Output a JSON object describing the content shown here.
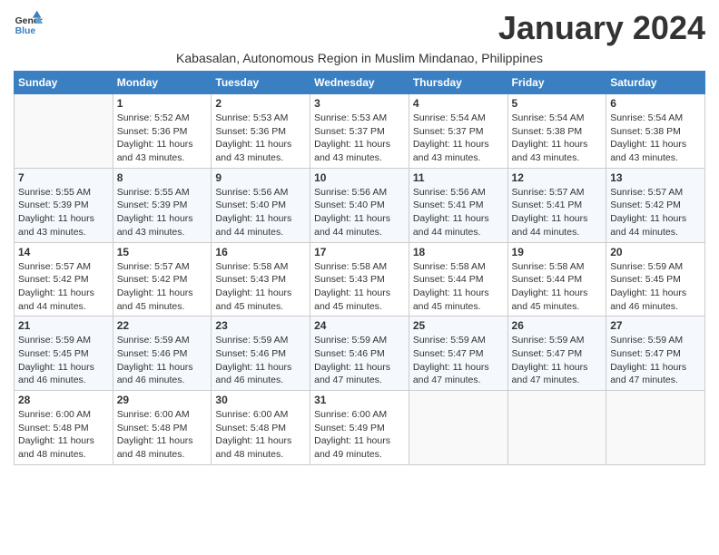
{
  "logo": {
    "general": "General",
    "blue": "Blue"
  },
  "title": "January 2024",
  "subtitle": "Kabasalan, Autonomous Region in Muslim Mindanao, Philippines",
  "days_of_week": [
    "Sunday",
    "Monday",
    "Tuesday",
    "Wednesday",
    "Thursday",
    "Friday",
    "Saturday"
  ],
  "weeks": [
    [
      {
        "num": "",
        "sunrise": "",
        "sunset": "",
        "daylight": ""
      },
      {
        "num": "1",
        "sunrise": "Sunrise: 5:52 AM",
        "sunset": "Sunset: 5:36 PM",
        "daylight": "Daylight: 11 hours and 43 minutes."
      },
      {
        "num": "2",
        "sunrise": "Sunrise: 5:53 AM",
        "sunset": "Sunset: 5:36 PM",
        "daylight": "Daylight: 11 hours and 43 minutes."
      },
      {
        "num": "3",
        "sunrise": "Sunrise: 5:53 AM",
        "sunset": "Sunset: 5:37 PM",
        "daylight": "Daylight: 11 hours and 43 minutes."
      },
      {
        "num": "4",
        "sunrise": "Sunrise: 5:54 AM",
        "sunset": "Sunset: 5:37 PM",
        "daylight": "Daylight: 11 hours and 43 minutes."
      },
      {
        "num": "5",
        "sunrise": "Sunrise: 5:54 AM",
        "sunset": "Sunset: 5:38 PM",
        "daylight": "Daylight: 11 hours and 43 minutes."
      },
      {
        "num": "6",
        "sunrise": "Sunrise: 5:54 AM",
        "sunset": "Sunset: 5:38 PM",
        "daylight": "Daylight: 11 hours and 43 minutes."
      }
    ],
    [
      {
        "num": "7",
        "sunrise": "Sunrise: 5:55 AM",
        "sunset": "Sunset: 5:39 PM",
        "daylight": "Daylight: 11 hours and 43 minutes."
      },
      {
        "num": "8",
        "sunrise": "Sunrise: 5:55 AM",
        "sunset": "Sunset: 5:39 PM",
        "daylight": "Daylight: 11 hours and 43 minutes."
      },
      {
        "num": "9",
        "sunrise": "Sunrise: 5:56 AM",
        "sunset": "Sunset: 5:40 PM",
        "daylight": "Daylight: 11 hours and 44 minutes."
      },
      {
        "num": "10",
        "sunrise": "Sunrise: 5:56 AM",
        "sunset": "Sunset: 5:40 PM",
        "daylight": "Daylight: 11 hours and 44 minutes."
      },
      {
        "num": "11",
        "sunrise": "Sunrise: 5:56 AM",
        "sunset": "Sunset: 5:41 PM",
        "daylight": "Daylight: 11 hours and 44 minutes."
      },
      {
        "num": "12",
        "sunrise": "Sunrise: 5:57 AM",
        "sunset": "Sunset: 5:41 PM",
        "daylight": "Daylight: 11 hours and 44 minutes."
      },
      {
        "num": "13",
        "sunrise": "Sunrise: 5:57 AM",
        "sunset": "Sunset: 5:42 PM",
        "daylight": "Daylight: 11 hours and 44 minutes."
      }
    ],
    [
      {
        "num": "14",
        "sunrise": "Sunrise: 5:57 AM",
        "sunset": "Sunset: 5:42 PM",
        "daylight": "Daylight: 11 hours and 44 minutes."
      },
      {
        "num": "15",
        "sunrise": "Sunrise: 5:57 AM",
        "sunset": "Sunset: 5:42 PM",
        "daylight": "Daylight: 11 hours and 45 minutes."
      },
      {
        "num": "16",
        "sunrise": "Sunrise: 5:58 AM",
        "sunset": "Sunset: 5:43 PM",
        "daylight": "Daylight: 11 hours and 45 minutes."
      },
      {
        "num": "17",
        "sunrise": "Sunrise: 5:58 AM",
        "sunset": "Sunset: 5:43 PM",
        "daylight": "Daylight: 11 hours and 45 minutes."
      },
      {
        "num": "18",
        "sunrise": "Sunrise: 5:58 AM",
        "sunset": "Sunset: 5:44 PM",
        "daylight": "Daylight: 11 hours and 45 minutes."
      },
      {
        "num": "19",
        "sunrise": "Sunrise: 5:58 AM",
        "sunset": "Sunset: 5:44 PM",
        "daylight": "Daylight: 11 hours and 45 minutes."
      },
      {
        "num": "20",
        "sunrise": "Sunrise: 5:59 AM",
        "sunset": "Sunset: 5:45 PM",
        "daylight": "Daylight: 11 hours and 46 minutes."
      }
    ],
    [
      {
        "num": "21",
        "sunrise": "Sunrise: 5:59 AM",
        "sunset": "Sunset: 5:45 PM",
        "daylight": "Daylight: 11 hours and 46 minutes."
      },
      {
        "num": "22",
        "sunrise": "Sunrise: 5:59 AM",
        "sunset": "Sunset: 5:46 PM",
        "daylight": "Daylight: 11 hours and 46 minutes."
      },
      {
        "num": "23",
        "sunrise": "Sunrise: 5:59 AM",
        "sunset": "Sunset: 5:46 PM",
        "daylight": "Daylight: 11 hours and 46 minutes."
      },
      {
        "num": "24",
        "sunrise": "Sunrise: 5:59 AM",
        "sunset": "Sunset: 5:46 PM",
        "daylight": "Daylight: 11 hours and 47 minutes."
      },
      {
        "num": "25",
        "sunrise": "Sunrise: 5:59 AM",
        "sunset": "Sunset: 5:47 PM",
        "daylight": "Daylight: 11 hours and 47 minutes."
      },
      {
        "num": "26",
        "sunrise": "Sunrise: 5:59 AM",
        "sunset": "Sunset: 5:47 PM",
        "daylight": "Daylight: 11 hours and 47 minutes."
      },
      {
        "num": "27",
        "sunrise": "Sunrise: 5:59 AM",
        "sunset": "Sunset: 5:47 PM",
        "daylight": "Daylight: 11 hours and 47 minutes."
      }
    ],
    [
      {
        "num": "28",
        "sunrise": "Sunrise: 6:00 AM",
        "sunset": "Sunset: 5:48 PM",
        "daylight": "Daylight: 11 hours and 48 minutes."
      },
      {
        "num": "29",
        "sunrise": "Sunrise: 6:00 AM",
        "sunset": "Sunset: 5:48 PM",
        "daylight": "Daylight: 11 hours and 48 minutes."
      },
      {
        "num": "30",
        "sunrise": "Sunrise: 6:00 AM",
        "sunset": "Sunset: 5:48 PM",
        "daylight": "Daylight: 11 hours and 48 minutes."
      },
      {
        "num": "31",
        "sunrise": "Sunrise: 6:00 AM",
        "sunset": "Sunset: 5:49 PM",
        "daylight": "Daylight: 11 hours and 49 minutes."
      },
      {
        "num": "",
        "sunrise": "",
        "sunset": "",
        "daylight": ""
      },
      {
        "num": "",
        "sunrise": "",
        "sunset": "",
        "daylight": ""
      },
      {
        "num": "",
        "sunrise": "",
        "sunset": "",
        "daylight": ""
      }
    ]
  ]
}
